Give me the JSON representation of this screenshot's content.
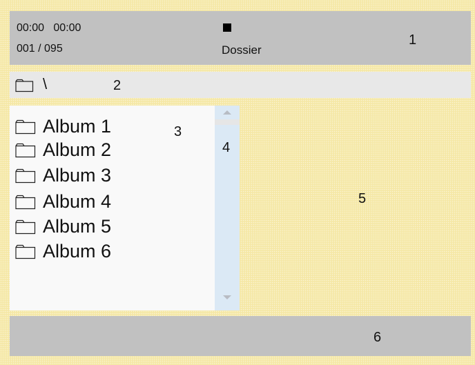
{
  "status_bar": {
    "elapsed_time": "00:00",
    "total_time": "00:00",
    "track_counter": "001 / 095",
    "playback_state_icon": "stop-icon",
    "mode_label": "Dossier"
  },
  "path_bar": {
    "folder_icon": "folder-icon",
    "path": "\\"
  },
  "file_list": {
    "items": [
      {
        "icon": "folder-icon",
        "label": "Album 1"
      },
      {
        "icon": "folder-icon",
        "label": "Album 2"
      },
      {
        "icon": "folder-icon",
        "label": "Album 3"
      },
      {
        "icon": "folder-icon",
        "label": "Album 4"
      },
      {
        "icon": "folder-icon",
        "label": "Album 5"
      },
      {
        "icon": "folder-icon",
        "label": "Album 6"
      }
    ]
  },
  "scrollbar": {
    "up_icon": "scroll-up-arrow-icon",
    "down_icon": "scroll-down-arrow-icon"
  },
  "region_markers": {
    "status_bar": "1",
    "path_bar": "2",
    "file_list": "3",
    "scrollbar": "4",
    "preview_area": "5",
    "bottom_bar": "6"
  },
  "colors": {
    "bars": "#c1c1c1",
    "path_bar": "#e8e8e8",
    "list_background": "#f9f9f9",
    "scrollbar": "#dbe9f5",
    "page_background": "#f5e8a6"
  }
}
